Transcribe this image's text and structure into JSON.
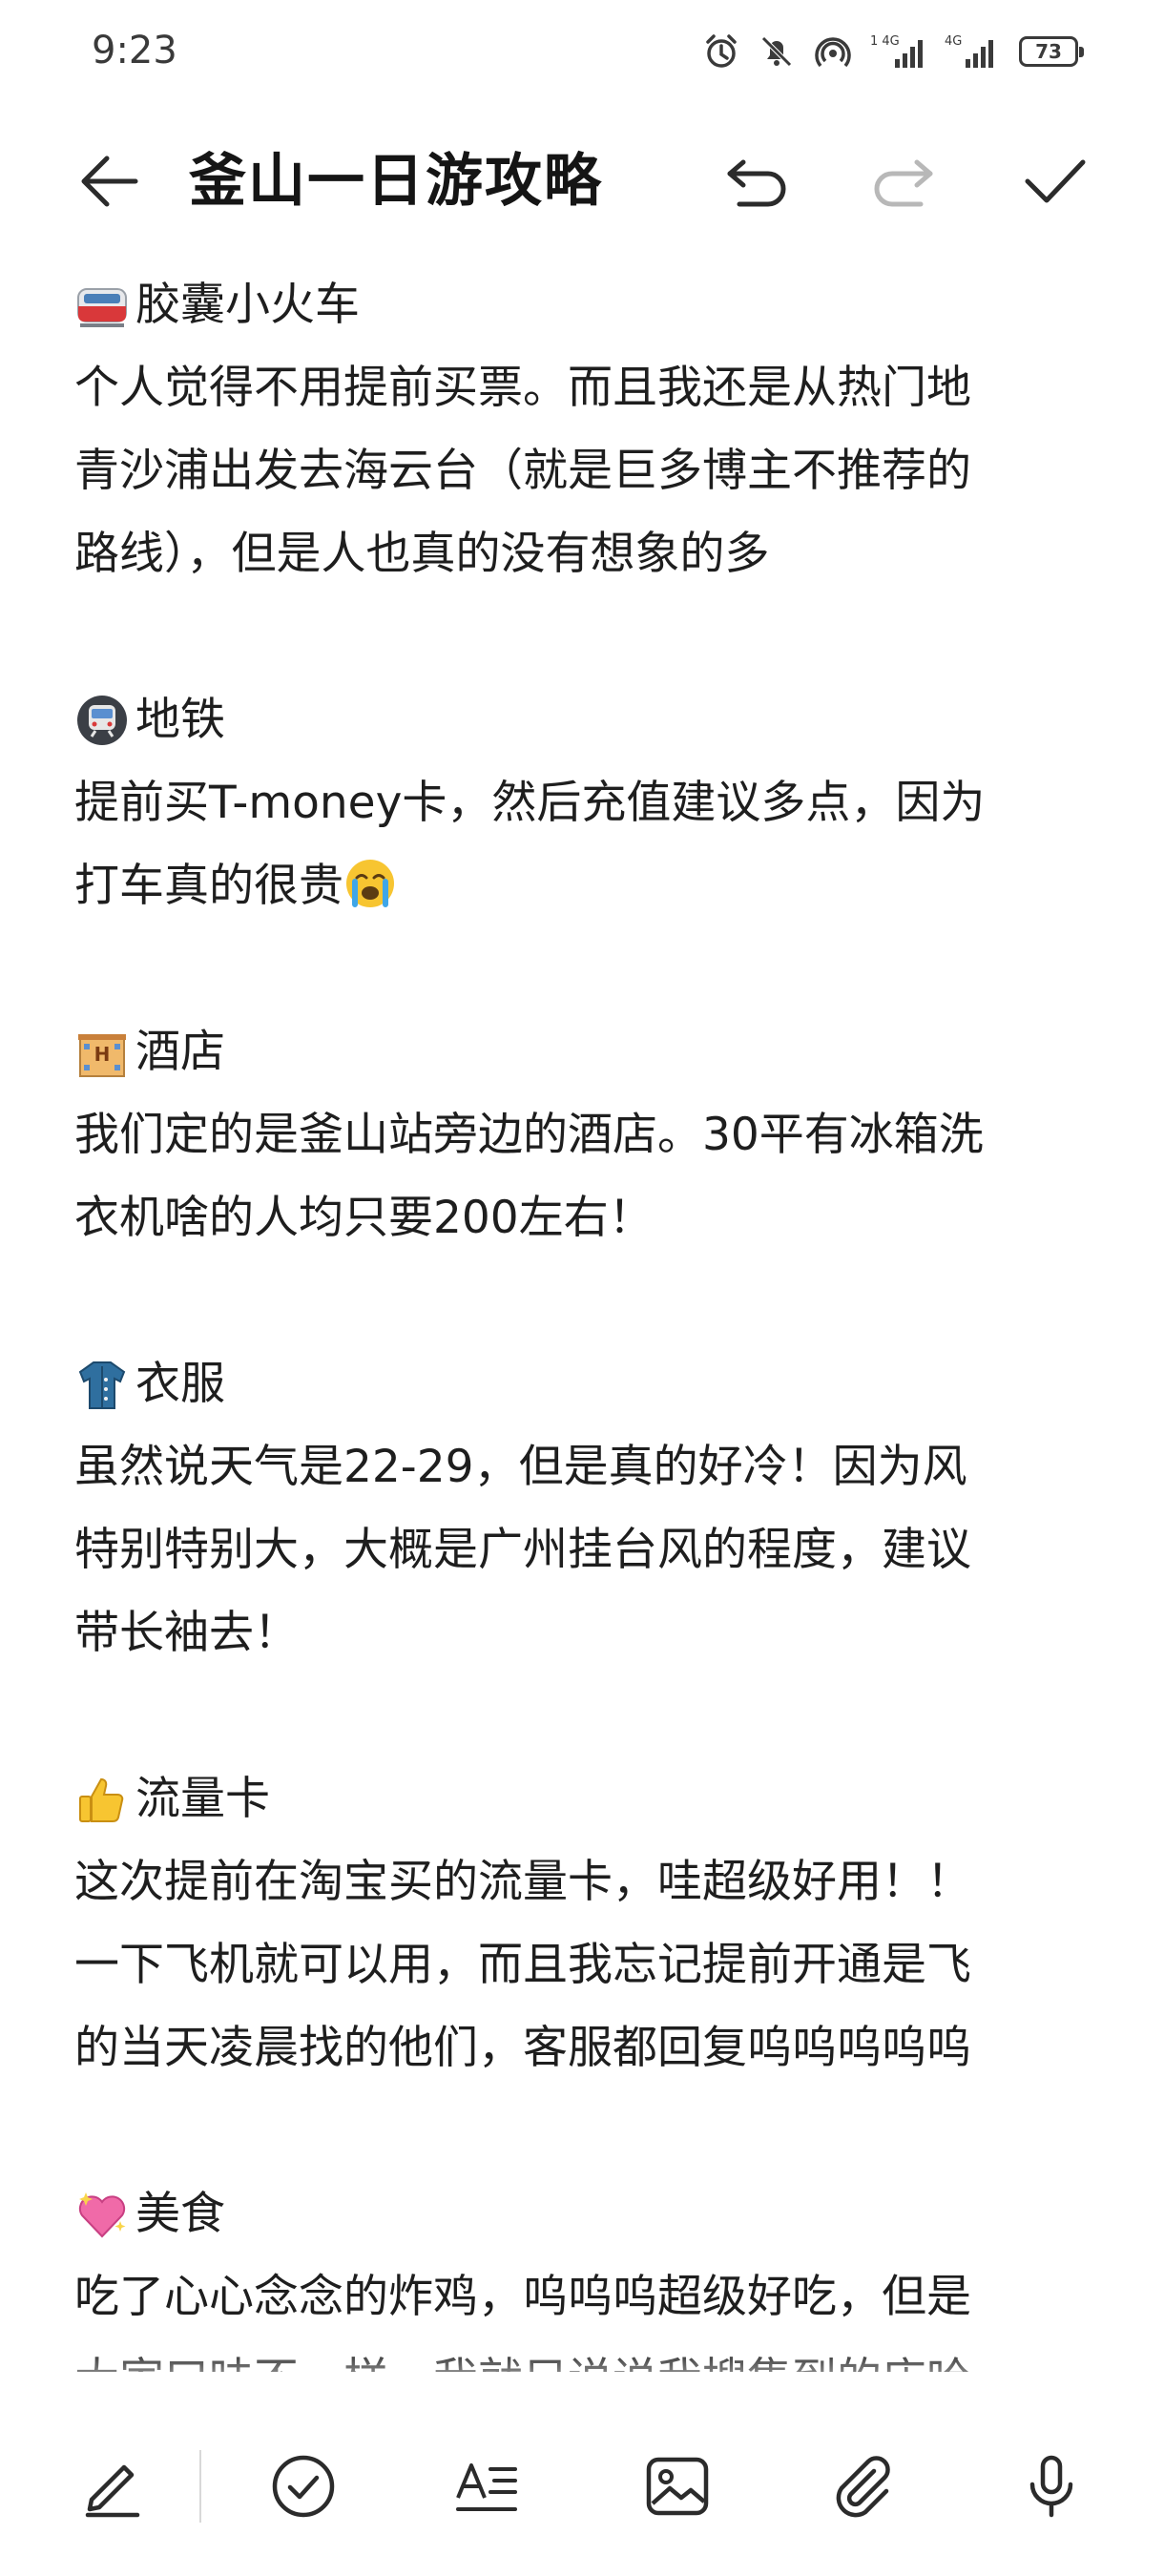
{
  "status_bar": {
    "time": "9:23",
    "battery": "73",
    "icons": [
      "alarm-icon",
      "mute-icon",
      "hotspot-icon",
      "signal-4g-icon",
      "signal-4g-icon-2",
      "battery-icon"
    ]
  },
  "toolbar": {
    "title": "釜山一日游攻略",
    "back_icon": "back-arrow-icon",
    "undo_icon": "undo-icon",
    "redo_icon": "redo-icon",
    "confirm_icon": "check-icon"
  },
  "note": {
    "sections": [
      {
        "emoji": "train-emoji",
        "heading": "胶囊小火车",
        "lines": [
          "个人觉得不用提前买票。而且我还是从热门地",
          "青沙浦出发去海云台（就是巨多博主不推荐的",
          "路线），但是人也真的没有想象的多"
        ]
      },
      {
        "emoji": "metro-emoji",
        "heading": "地铁",
        "lines": [
          "提前买T-money卡，然后充值建议多点，因为",
          "打车真的很贵"
        ]
      },
      {
        "emoji": "hotel-emoji",
        "heading": "酒店",
        "lines": [
          "我们定的是釜山站旁边的酒店。30平有冰箱洗",
          "衣机啥的人均只要200左右！"
        ]
      },
      {
        "emoji": "coat-emoji",
        "heading": "衣服",
        "lines": [
          "虽然说天气是22-29，但是真的好冷！因为风",
          "特别特别大，大概是广州挂台风的程度，建议",
          "带长袖去！"
        ]
      },
      {
        "emoji": "thumbs-up-emoji",
        "heading": "流量卡",
        "lines": [
          "这次提前在淘宝买的流量卡，哇超级好用！！",
          "一下飞机就可以用，而且我忘记提前开通是飞",
          "的当天凌晨找的他们，客服都回复呜呜呜呜呜"
        ]
      },
      {
        "emoji": "sparkling-heart-emoji",
        "heading": "美食",
        "lines": [
          "吃了心心念念的炸鸡，呜呜呜超级好吃，但是",
          "大家口味不一样，我就只说说我搜集到的店哈"
        ]
      }
    ],
    "crying_emoji": "crying-face-emoji"
  },
  "bottom_bar": {
    "icons": [
      "handwriting-pen-icon",
      "checklist-icon",
      "text-style-icon",
      "image-icon",
      "attachment-icon",
      "microphone-icon"
    ]
  },
  "colors": {
    "text": "#1e1e1e",
    "icon": "#2b2b2b",
    "icon_disabled": "#b8b8b8",
    "background": "#ffffff"
  }
}
